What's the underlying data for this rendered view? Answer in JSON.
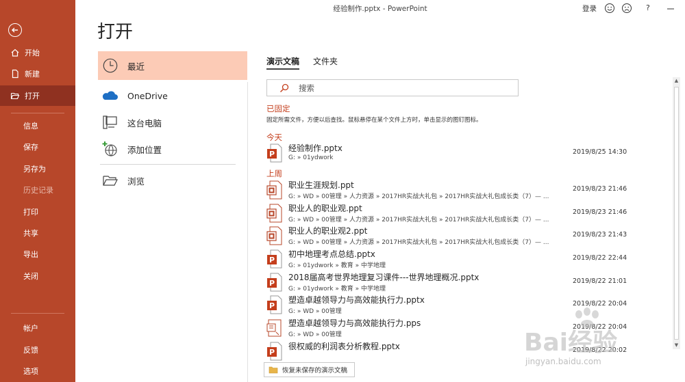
{
  "window": {
    "title": "经验制作.pptx  -  PowerPoint",
    "login": "登录",
    "help": "?"
  },
  "nav": {
    "items": [
      {
        "label": "开始",
        "icon": "home-icon"
      },
      {
        "label": "新建",
        "icon": "new-file-icon"
      },
      {
        "label": "打开",
        "icon": "folder-open-icon"
      },
      {
        "label": "信息"
      },
      {
        "label": "保存"
      },
      {
        "label": "另存为"
      },
      {
        "label": "历史记录"
      },
      {
        "label": "打印"
      },
      {
        "label": "共享"
      },
      {
        "label": "导出"
      },
      {
        "label": "关闭"
      },
      {
        "label": "帐户"
      },
      {
        "label": "反馈"
      },
      {
        "label": "选项"
      }
    ]
  },
  "page": {
    "title": "打开"
  },
  "locations": [
    {
      "label": "最近",
      "icon": "clock-icon"
    },
    {
      "label": "OneDrive",
      "icon": "cloud-icon"
    },
    {
      "label": "这台电脑",
      "icon": "computer-icon"
    },
    {
      "label": "添加位置",
      "icon": "globe-add-icon"
    },
    {
      "label": "浏览",
      "icon": "folder-icon"
    }
  ],
  "tabs": [
    {
      "label": "演示文稿"
    },
    {
      "label": "文件夹"
    }
  ],
  "search": {
    "placeholder": "搜索"
  },
  "pinned": {
    "header": "已固定",
    "hint": "固定所需文件，方便以后查找。鼠标悬停在某个文件上方时，单击显示的图钉图标。"
  },
  "groups": {
    "today": "今天",
    "last_week": "上周"
  },
  "files": [
    {
      "name": "经验制作.pptx",
      "path": "G: » 01ydwork",
      "date": "2019/8/25 14:30"
    },
    {
      "name": "职业生涯规划.ppt",
      "path": "G: » WD » 00管理 » 人力资源 » 2017HR实战大礼包 » 2017HR实战大礼包成长类（7）— ...",
      "date": "2019/8/23 21:46"
    },
    {
      "name": "职业人的职业观.ppt",
      "path": "G: » WD » 00管理 » 人力资源 » 2017HR实战大礼包 » 2017HR实战大礼包成长类（7）— ...",
      "date": "2019/8/23 21:46"
    },
    {
      "name": "职业人的职业观2.ppt",
      "path": "G: » WD » 00管理 » 人力资源 » 2017HR实战大礼包 » 2017HR实战大礼包成长类（7）— ...",
      "date": "2019/8/23 21:43"
    },
    {
      "name": "初中地理考点总结.pptx",
      "path": "G: » 01ydwork » 教育 » 中学地理",
      "date": "2019/8/22 22:44"
    },
    {
      "name": "2018届高考世界地理复习课件---世界地理概况.pptx",
      "path": "G: » 01ydwork » 教育 » 中学地理",
      "date": "2019/8/22 21:01"
    },
    {
      "name": "塑造卓越领导力与高效能执行力.pptx",
      "path": "G: » WD » 00管理",
      "date": "2019/8/22 20:04"
    },
    {
      "name": "塑造卓越领导力与高效能执行力.pps",
      "path": "G: » WD » 00管理",
      "date": "2019/8/22 20:04"
    },
    {
      "name": "很权威的利润表分析教程.pptx",
      "path": "",
      "date": "2019/8/22 20:02"
    }
  ],
  "recover": {
    "label": "恢复未保存的演示文稿"
  },
  "watermark": {
    "main": "Bai经验",
    "sub": "jingyan.baidu.com"
  },
  "colors": {
    "accent": "#b7472a",
    "selected": "#fccbb6",
    "section": "#c43e1c"
  }
}
